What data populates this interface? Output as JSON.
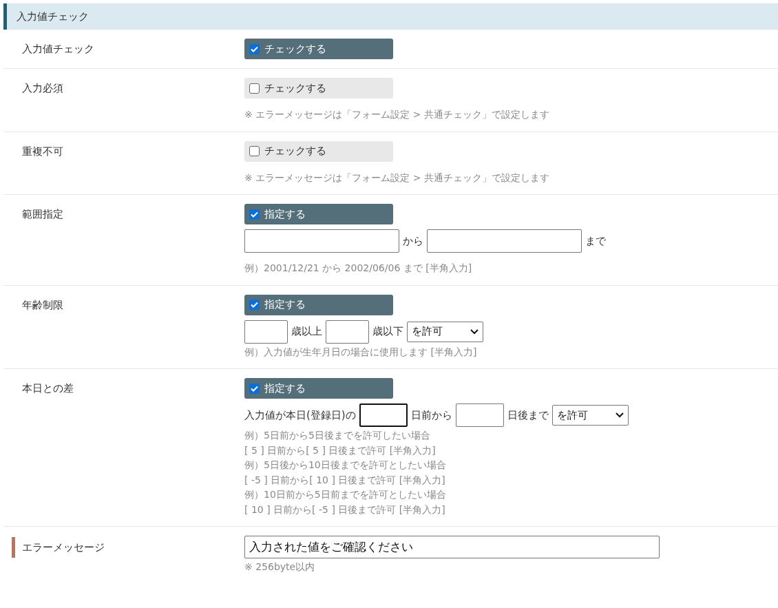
{
  "section": {
    "title": "入力値チェック"
  },
  "rows": [
    {
      "label": "入力値チェック",
      "marked": false,
      "toggle": {
        "label": "チェックする",
        "checked": true
      }
    },
    {
      "label": "入力必須",
      "marked": false,
      "toggle": {
        "label": "チェックする",
        "checked": false
      },
      "notes": [
        "※ エラーメッセージは「フォーム設定 > 共通チェック」で設定します"
      ]
    },
    {
      "label": "重複不可",
      "marked": false,
      "toggle": {
        "label": "チェックする",
        "checked": false
      },
      "notes": [
        "※ エラーメッセージは「フォーム設定 > 共通チェック」で設定します"
      ]
    },
    {
      "label": "範囲指定",
      "marked": false,
      "toggle": {
        "label": "指定する",
        "checked": true
      },
      "inline": [
        {
          "kind": "date",
          "focused": false
        },
        {
          "kind": "label",
          "text": "から"
        },
        {
          "kind": "date",
          "focused": false
        },
        {
          "kind": "label",
          "text": "まで"
        }
      ],
      "notes": [
        "例）2001/12/21 から 2002/06/06 まで [半角入力]"
      ]
    },
    {
      "label": "年齢制限",
      "marked": false,
      "toggle": {
        "label": "指定する",
        "checked": true
      },
      "inline": [
        {
          "kind": "number",
          "focused": false
        },
        {
          "kind": "label",
          "text": "歳以上"
        },
        {
          "kind": "number",
          "focused": false
        },
        {
          "kind": "label",
          "text": "歳以下"
        },
        {
          "kind": "select",
          "value": "を許可"
        }
      ],
      "notes": [
        "例）入力値が生年月日の場合に使用します [半角入力]"
      ]
    },
    {
      "label": "本日との差",
      "marked": false,
      "toggle": {
        "label": "指定する",
        "checked": true
      },
      "inline": [
        {
          "kind": "label",
          "text": "入力値が本日(登録日)の"
        },
        {
          "kind": "days",
          "focused": true
        },
        {
          "kind": "label",
          "text": "日前から"
        },
        {
          "kind": "days",
          "focused": false
        },
        {
          "kind": "label",
          "text": "日後まで"
        },
        {
          "kind": "select",
          "value": "を許可"
        }
      ],
      "notes": [
        "例）5日前から5日後までを許可したい場合",
        "[ 5 ] 日前から[ 5 ] 日後まで許可 [半角入力]",
        "例）5日後から10日後までを許可としたい場合",
        "[ -5 ] 日前から[ 10 ] 日後まで許可 [半角入力]",
        "例）10日前から5日前までを許可としたい場合",
        "[ 10 ] 日前から[ -5 ] 日後まで許可 [半角入力]"
      ]
    },
    {
      "label": "エラーメッセージ",
      "marked": true,
      "inline": [
        {
          "kind": "text",
          "value": "入力された値をご確認ください",
          "focused": false
        }
      ],
      "notes": [
        "※ 256byte以内"
      ]
    }
  ]
}
